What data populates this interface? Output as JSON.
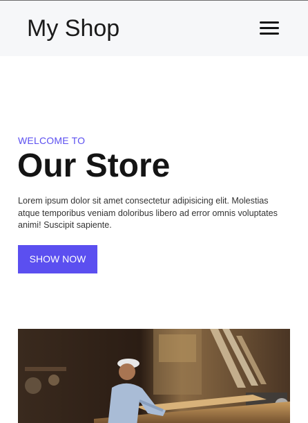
{
  "navbar": {
    "brand": "My Shop",
    "menu_icon": "hamburger-menu-icon"
  },
  "hero": {
    "eyebrow": "WELCOME TO",
    "title": "Our Store",
    "description": "Lorem ipsum dolor sit amet consectetur adipisicing elit. Molestias atque temporibus veniam doloribus libero ad error omnis voluptates animi! Suscipit sapiente.",
    "cta_label": "SHOW NOW",
    "image_subject": "carpenter-workshop-photo"
  },
  "colors": {
    "accent": "#5b4ff0",
    "navbar_bg": "#f6f7f9",
    "text": "#141414"
  }
}
